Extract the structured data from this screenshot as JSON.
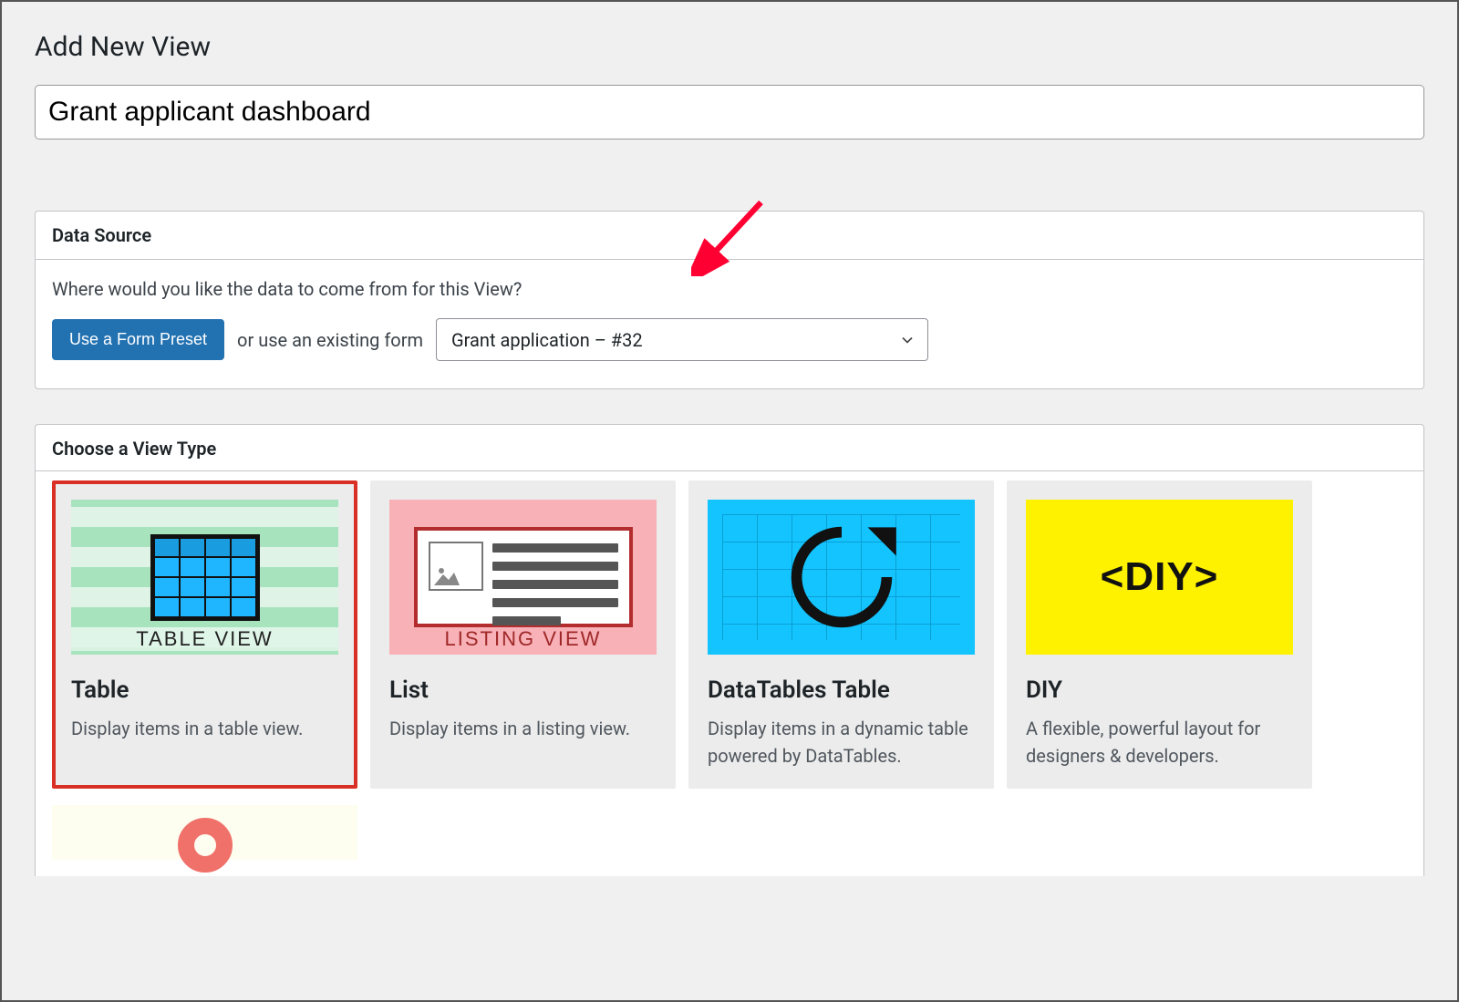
{
  "page": {
    "title": "Add New View"
  },
  "title_input": {
    "value": "Grant applicant dashboard"
  },
  "data_source": {
    "panel_title": "Data Source",
    "question": "Where would you like the data to come from for this View?",
    "preset_button": "Use a Form Preset",
    "or_text": "or use an existing form",
    "selected_form": "Grant application – #32"
  },
  "view_types": {
    "panel_title": "Choose a View Type",
    "cards": [
      {
        "label": "TABLE VIEW",
        "title": "Table",
        "desc": "Display items in a table view."
      },
      {
        "label": "LISTING VIEW",
        "title": "List",
        "desc": "Display items in a listing view."
      },
      {
        "label": "",
        "title": "DataTables Table",
        "desc": "Display items in a dynamic table powered by DataTables."
      },
      {
        "label": "<DIY>",
        "title": "DIY",
        "desc": "A flexible, powerful layout for designers & developers."
      }
    ]
  }
}
